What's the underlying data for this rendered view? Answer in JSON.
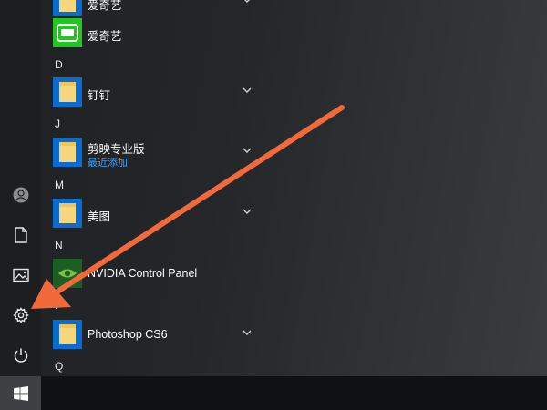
{
  "groups": {
    "d": "D",
    "j": "J",
    "m": "M",
    "n": "N",
    "p": "P",
    "q": "Q"
  },
  "apps": {
    "aiqiyi_folder": "爱奇艺",
    "aiqiyi": "爱奇艺",
    "dingding": "钉钉",
    "jianying": "剪映专业版",
    "jianying_sub": "最近添加",
    "meitu": "美图",
    "nvidia": "NVIDIA Control Panel",
    "photoshop": "Photoshop CS6"
  },
  "colors": {
    "tile_blue": "#0a6cd0",
    "iqiyi_green": "#21c721",
    "nvidia_green": "#1b5f22",
    "arrow": "#f26a3c",
    "recent_blue": "#3ba1ff"
  },
  "icons": {
    "rail": [
      "user-icon",
      "document-icon",
      "pictures-icon",
      "settings-icon",
      "power-icon"
    ],
    "start": "windows-logo-icon"
  }
}
